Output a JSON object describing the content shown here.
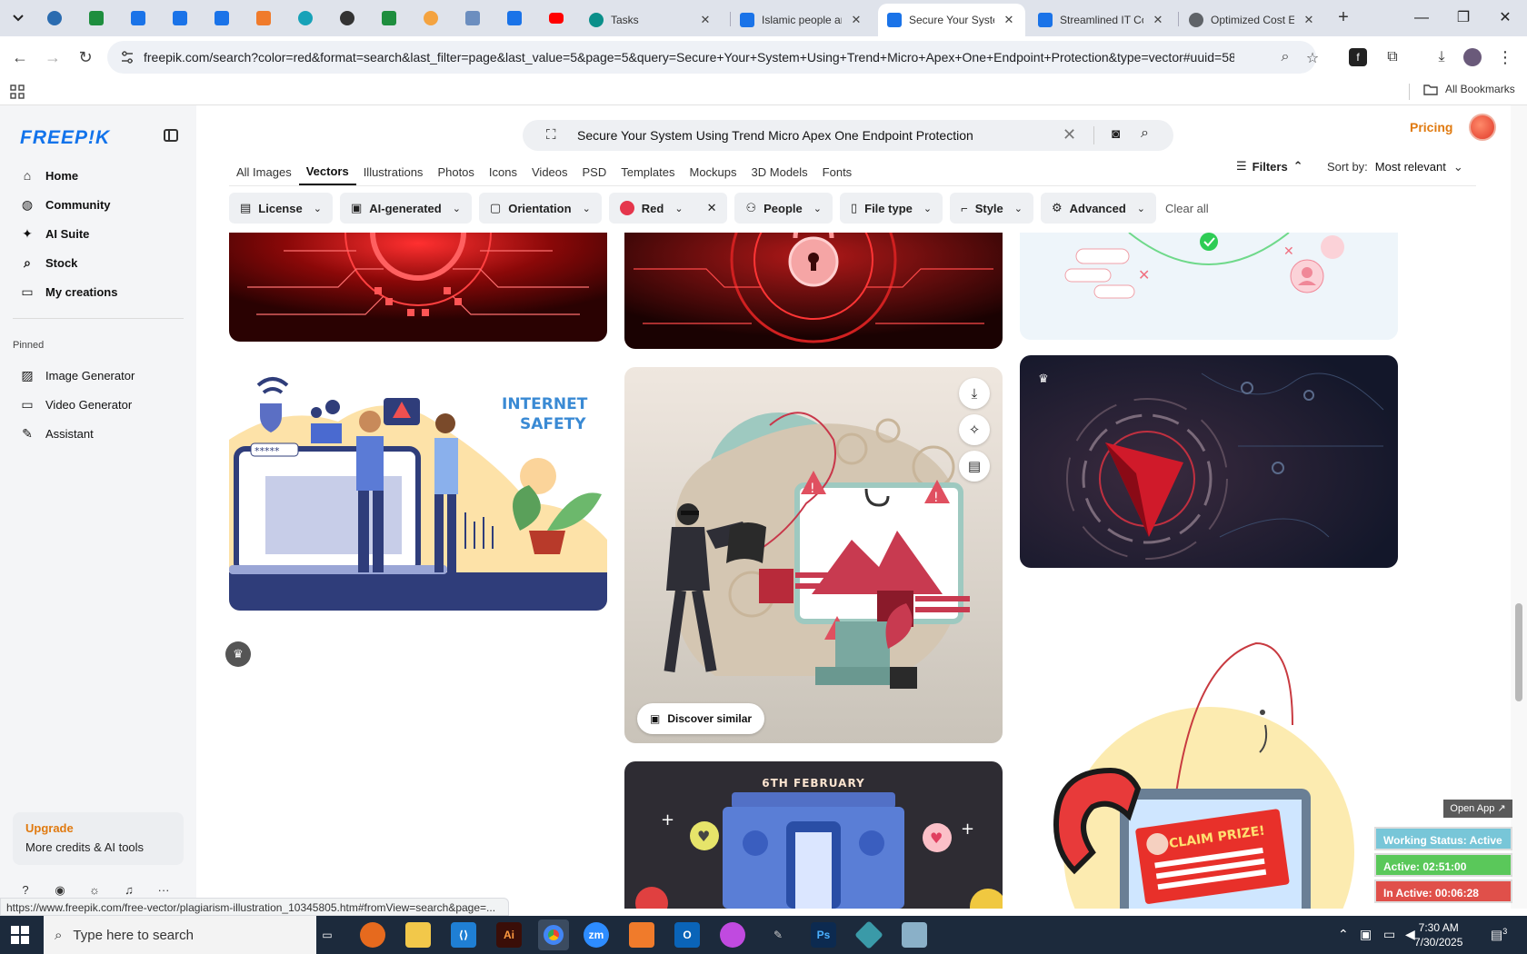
{
  "browser": {
    "tabs": [
      {
        "title": "Tasks",
        "favicon_color": "#0b8f8a"
      },
      {
        "title": "Islamic people an",
        "favicon_color": "#1a73e8"
      },
      {
        "title": "Secure Your Syste",
        "favicon_color": "#1a73e8"
      },
      {
        "title": "Streamlined IT Co",
        "favicon_color": "#1a73e8"
      },
      {
        "title": "Optimized Cost E",
        "favicon_color": "#5f6368"
      }
    ],
    "url": "freepik.com/search?color=red&format=search&last_filter=page&last_value=5&page=5&query=Secure+Your+System+Using+Trend+Micro+Apex+One+Endpoint+Protection&type=vector#uuid=58...",
    "bookmarks_all": "All Bookmarks",
    "status_url": "https://www.freepik.com/free-vector/plagiarism-illustration_10345805.htm#fromView=search&page=..."
  },
  "sidebar": {
    "logo": "FREEP!K",
    "items": [
      {
        "label": "Home",
        "icon": "home-icon",
        "glyph": "⌂"
      },
      {
        "label": "Community",
        "icon": "globe-icon",
        "glyph": "◍"
      },
      {
        "label": "AI Suite",
        "icon": "sparkle-icon",
        "glyph": "✦"
      },
      {
        "label": "Stock",
        "icon": "search-icon",
        "glyph": "⌕"
      },
      {
        "label": "My creations",
        "icon": "folder-icon",
        "glyph": "▭"
      }
    ],
    "pinned_label": "Pinned",
    "pinned": [
      {
        "label": "Image Generator",
        "icon": "image-icon",
        "glyph": "▨"
      },
      {
        "label": "Video Generator",
        "icon": "video-icon",
        "glyph": "▭"
      },
      {
        "label": "Assistant",
        "icon": "chat-icon",
        "glyph": "✎"
      }
    ],
    "upgrade_title": "Upgrade",
    "upgrade_sub": "More credits & AI tools"
  },
  "header": {
    "search_query": "Secure Your System Using Trend Micro Apex One Endpoint Protection",
    "pricing": "Pricing",
    "type_tabs": [
      "All Images",
      "Vectors",
      "Illustrations",
      "Photos",
      "Icons",
      "Videos",
      "PSD",
      "Templates",
      "Mockups",
      "3D Models",
      "Fonts"
    ],
    "active_type": "Vectors",
    "filters_label": "Filters",
    "sort_label": "Sort by:",
    "sort_value": "Most relevant",
    "chips": [
      "License",
      "AI-generated",
      "Orientation",
      "Red",
      "People",
      "File type",
      "Style",
      "Advanced"
    ],
    "clear_all": "Clear all",
    "selected_color": "#e5364c"
  },
  "results": {
    "internet_safety_line1": "INTERNET",
    "internet_safety_line2": "SAFETY",
    "discover_similar": "Discover similar",
    "february_caption": "6TH FEBRUARY",
    "claim_prize": "CLAIM PRIZE!"
  },
  "tracker": {
    "open_app": "Open App ↗",
    "working_status": "Working Status: Active",
    "active": "Active: 02:51:00",
    "inactive": "In Active: 00:06:28"
  },
  "taskbar": {
    "search_placeholder": "Type here to search",
    "time": "7:30 AM",
    "date": "7/30/2025",
    "notifications": "3"
  }
}
